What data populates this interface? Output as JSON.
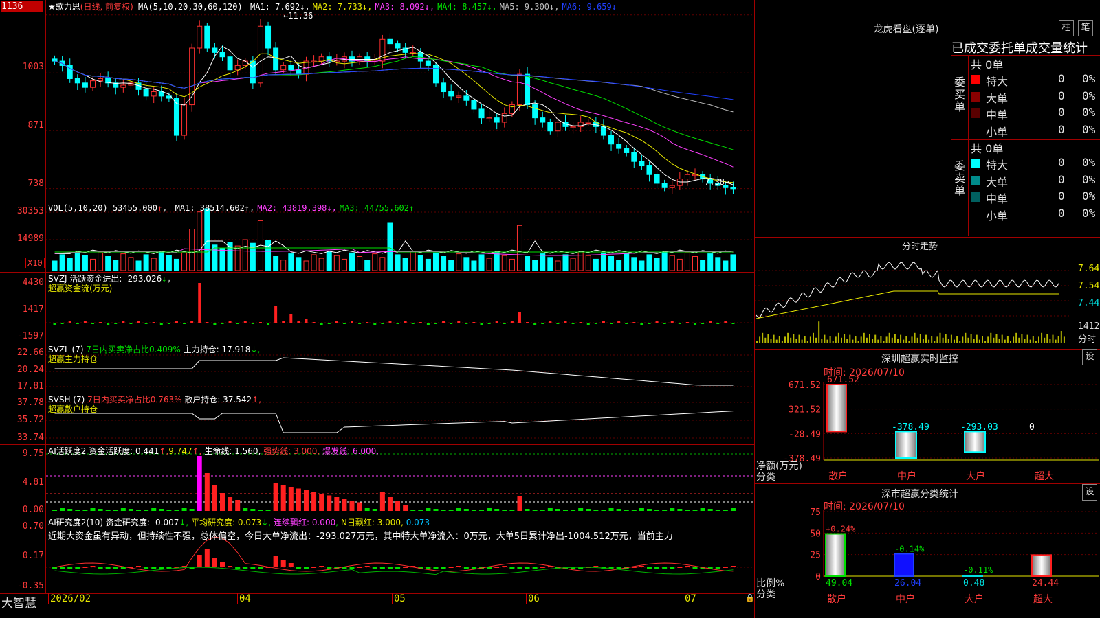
{
  "stock": {
    "name": "歌力思",
    "mode": "(日线, 前复权)"
  },
  "price_pane": {
    "ma_title": "MA(5,10,20,30,60,120)",
    "ma": [
      {
        "label": "MA1:",
        "value": "7.692",
        "arrow": "↓",
        "color": "#ffffff"
      },
      {
        "label": "MA2:",
        "value": "7.733",
        "arrow": "↓",
        "color": "#e8e800"
      },
      {
        "label": "MA3:",
        "value": "8.092",
        "arrow": "↓",
        "color": "#ff40ff"
      },
      {
        "label": "MA4:",
        "value": "8.457",
        "arrow": "↓",
        "color": "#00e000"
      },
      {
        "label": "MA5:",
        "value": "9.300",
        "arrow": "↓",
        "color": "#c0c0c0"
      },
      {
        "label": "MA6:",
        "value": "9.659",
        "arrow": "↓",
        "color": "#2040ff"
      }
    ],
    "yticks": [
      "1136",
      "1003",
      "871",
      "738"
    ],
    "high_label": "11.36",
    "low_label": "7.38"
  },
  "vol_pane": {
    "title": "VOL(5,10,20)",
    "value": "53455.000",
    "ma": [
      {
        "label": "MA1:",
        "value": "38514.602",
        "arrow": "↑",
        "color": "#ffffff"
      },
      {
        "label": "MA2:",
        "value": "43819.398",
        "arrow": "↓",
        "color": "#ff40ff"
      },
      {
        "label": "MA3:",
        "value": "44755.602",
        "arrow": "↑",
        "color": "#00e000"
      }
    ],
    "yticks": [
      "30353",
      "14989"
    ],
    "unit": "X10"
  },
  "svzj_pane": {
    "line1": "SVZJ  活跃资金进出: -293.026",
    "arrow": "↓",
    "line2": "超赢资金流(万元)",
    "yticks": [
      "4430",
      "1417",
      "-1597"
    ]
  },
  "svzl_pane": {
    "prefix": "SVZL (7) ",
    "ratio": "7日内买卖净占比0.409%",
    "hold": "主力持仓: 17.918",
    "arrow": "↓,",
    "line2": "超赢主力持仓",
    "yticks": [
      "22.66",
      "20.24",
      "17.81"
    ]
  },
  "svsh_pane": {
    "prefix": "SVSH (7) ",
    "ratio": "7日内买卖净占比0.763%",
    "hold": "散户持仓: 37.542",
    "arrow": "↑,",
    "line2": "超赢散户持仓",
    "yticks": [
      "37.78",
      "35.72",
      "33.74"
    ]
  },
  "ai_active": {
    "title": "AI活跃度2 资金活跃度: 0.441",
    "v1": "9.747",
    "v2": "生命线: 1.560,",
    "v3": "强势线: 3.000,",
    "v4": "爆发线: 6.000,",
    "yticks": [
      "9.75",
      "4.81",
      "0.00"
    ]
  },
  "ai_research": {
    "title": "AI研究度2(10) 资金研究度: -0.007",
    "avg": "平均研究度: 0.073",
    "lx": "连续飘红: 0.000",
    "nr": "N日飘红: 3.000,",
    "last": "0.073",
    "comment": "近期大资金虽有异动，但持续性不强，总体偏空，今日大单净流出：-293.027万元，其中特大单净流入：0万元，大单5日累计净出-1004.512万元，当前主力",
    "yticks": [
      "0.70",
      "0.17",
      "-0.35"
    ]
  },
  "xaxis": {
    "labels": [
      "2026/02",
      "04",
      "05",
      "06",
      "07"
    ]
  },
  "brand": "大智慧",
  "right": {
    "lhb_title": "龙虎看盘(逐单)",
    "btn_a": "柱",
    "btn_b": "笔",
    "stats_title": "已成交委托单成交量统计",
    "buy": {
      "side": "委买单",
      "total": "共 0单",
      "rows": [
        {
          "name": "特大",
          "n": "0",
          "pct": "0%",
          "color": "#ff0000"
        },
        {
          "name": "大单",
          "n": "0",
          "pct": "0%",
          "color": "#8b0000"
        },
        {
          "name": "中单",
          "n": "0",
          "pct": "0%",
          "color": "#5a0000"
        },
        {
          "name": "小单",
          "n": "0",
          "pct": "0%",
          "color": "#000000"
        }
      ]
    },
    "sell": {
      "side": "委卖单",
      "total": "共 0单",
      "rows": [
        {
          "name": "特大",
          "n": "0",
          "pct": "0%",
          "color": "#00ffff"
        },
        {
          "name": "大单",
          "n": "0",
          "pct": "0%",
          "color": "#008b8b"
        },
        {
          "name": "中单",
          "n": "0",
          "pct": "0%",
          "color": "#006060"
        },
        {
          "name": "小单",
          "n": "0",
          "pct": "0%",
          "color": "#000000"
        }
      ]
    },
    "intraday": {
      "title": "分时走势",
      "yticks": [
        "7.64",
        "7.54",
        "7.44"
      ],
      "vol": "1412",
      "vol_label": "分时"
    },
    "sz_monitor": {
      "title": "深圳超赢实时监控",
      "btn": "设",
      "time": "时间: 2026/07/10",
      "yticks": [
        "671.52",
        "321.52",
        "-28.49",
        "-378.49"
      ],
      "ylabel": "净额(万元)",
      "xlabel": "分类",
      "cats": [
        "散户",
        "中户",
        "大户",
        "超大"
      ],
      "values": [
        "671.52",
        "-378.49",
        "-293.03",
        "0"
      ]
    },
    "sz_class": {
      "title": "深市超赢分类统计",
      "btn": "设",
      "time": "时间: 2026/07/10",
      "yticks": [
        "75",
        "50",
        "25",
        "0"
      ],
      "ylabel": "比例%",
      "xlabel": "分类",
      "cats": [
        "散户",
        "中户",
        "大户",
        "超大"
      ],
      "values": [
        "49.04",
        "26.04",
        "0.48",
        "24.44"
      ],
      "changes": [
        "+0.24%",
        "-0.14%",
        "-0.11%",
        ""
      ]
    }
  },
  "chart_data": [
    {
      "type": "candlestick",
      "title": "歌力思 (日线, 前复权)",
      "x": [
        "2026/02",
        "04",
        "05",
        "06",
        "07"
      ],
      "ylim": [
        7.2,
        11.45
      ],
      "yticks": [
        11.36,
        10.03,
        8.71,
        7.38
      ],
      "approx_close": [
        10.3,
        10.2,
        9.9,
        9.8,
        9.7,
        9.85,
        9.9,
        9.8,
        9.7,
        9.75,
        9.8,
        9.65,
        9.5,
        9.6,
        9.5,
        9.45,
        8.6,
        9.3,
        10.6,
        11.1,
        10.6,
        10.5,
        10.4,
        10.1,
        10.2,
        10.3,
        9.8,
        11.1,
        10.6,
        10.1,
        10.2,
        10.1,
        10.0,
        10.3,
        10.3,
        10.4,
        10.3,
        10.3,
        10.4,
        10.3,
        10.4,
        10.3,
        10.3,
        10.8,
        10.7,
        10.6,
        10.5,
        10.5,
        10.3,
        10.2,
        9.8,
        9.6,
        9.5,
        9.5,
        9.4,
        9.2,
        9.0,
        9.0,
        8.9,
        9.1,
        9.3,
        10.0,
        9.3,
        9.0,
        8.9,
        8.7,
        8.9,
        8.8,
        8.8,
        8.9,
        8.9,
        8.8,
        8.6,
        8.4,
        8.3,
        8.2,
        8.0,
        7.9,
        7.7,
        7.5,
        7.4,
        7.45,
        7.6,
        7.7,
        7.7,
        7.6,
        7.5,
        7.45,
        7.4,
        7.38
      ]
    }
  ]
}
